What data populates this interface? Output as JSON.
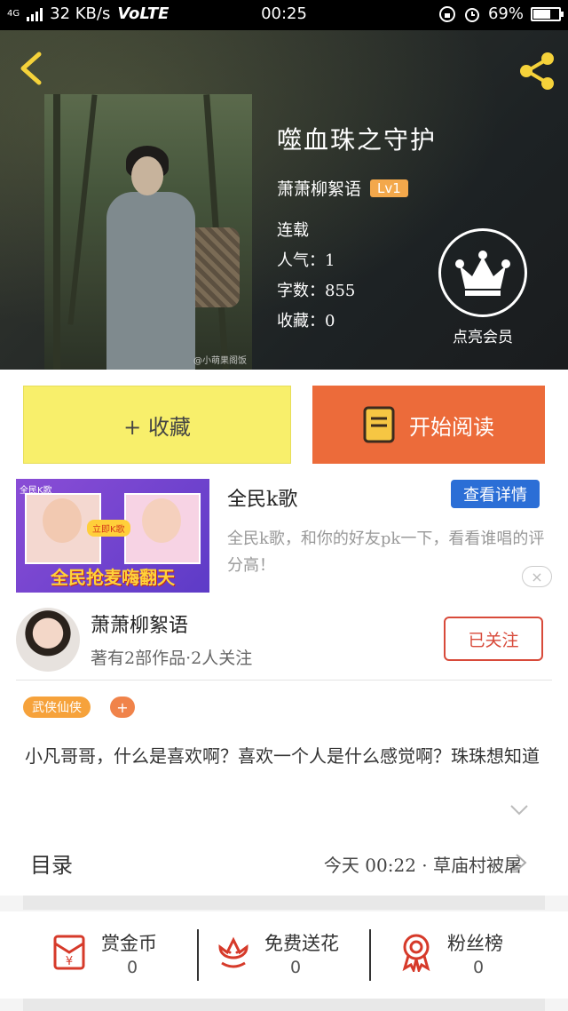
{
  "status_bar": {
    "network": "4G",
    "speed": "32 KB/s",
    "volte": "VoLTE",
    "time": "00:25",
    "battery": "69%",
    "battery_level": 0.69
  },
  "book": {
    "title": "噬血珠之守护",
    "author": "萧萧柳絮语",
    "level": "Lv1",
    "status": "连载",
    "popularity": "人气：1",
    "word_count": "字数：855",
    "favorites": "收藏：0",
    "cover_watermark": "@小萌果阁饭"
  },
  "vip": {
    "label": "点亮会员"
  },
  "actions": {
    "collect_label": "+ 收藏",
    "read_label": "开始阅读"
  },
  "ad": {
    "title": "全民k歌",
    "detail_button": "查看详情",
    "description": "全民k歌，和你的好友pk一下，看看谁唱的评分高！",
    "img_logo": "全民K歌",
    "img_pill": "立即K歌",
    "img_slogan": "全民抢麦嗨翻天",
    "close_symbol": "×"
  },
  "author_card": {
    "name": "萧萧柳絮语",
    "meta": "著有2部作品·2人关注",
    "follow_label": "已关注"
  },
  "description": {
    "tag": "武侠仙侠",
    "tag_add": "+",
    "text": "小凡哥哥，什么是喜欢啊？喜欢一个人是什么感觉啊？珠珠想知道"
  },
  "toc": {
    "label": "目录",
    "update": "今天 00:22 · 草庙村被屠"
  },
  "stats": [
    {
      "label": "赏金币",
      "value": "0",
      "icon": "red-envelope-icon"
    },
    {
      "label": "免费送花",
      "value": "0",
      "icon": "flower-icon"
    },
    {
      "label": "粉丝榜",
      "value": "0",
      "icon": "medal-icon"
    }
  ],
  "colors": {
    "collect_bg": "#f8ef6b",
    "read_bg": "#ec6b3a",
    "accent_red": "#d84a3a",
    "tag_orange": "#f6a23b",
    "ad_blue": "#2b6ed6"
  }
}
